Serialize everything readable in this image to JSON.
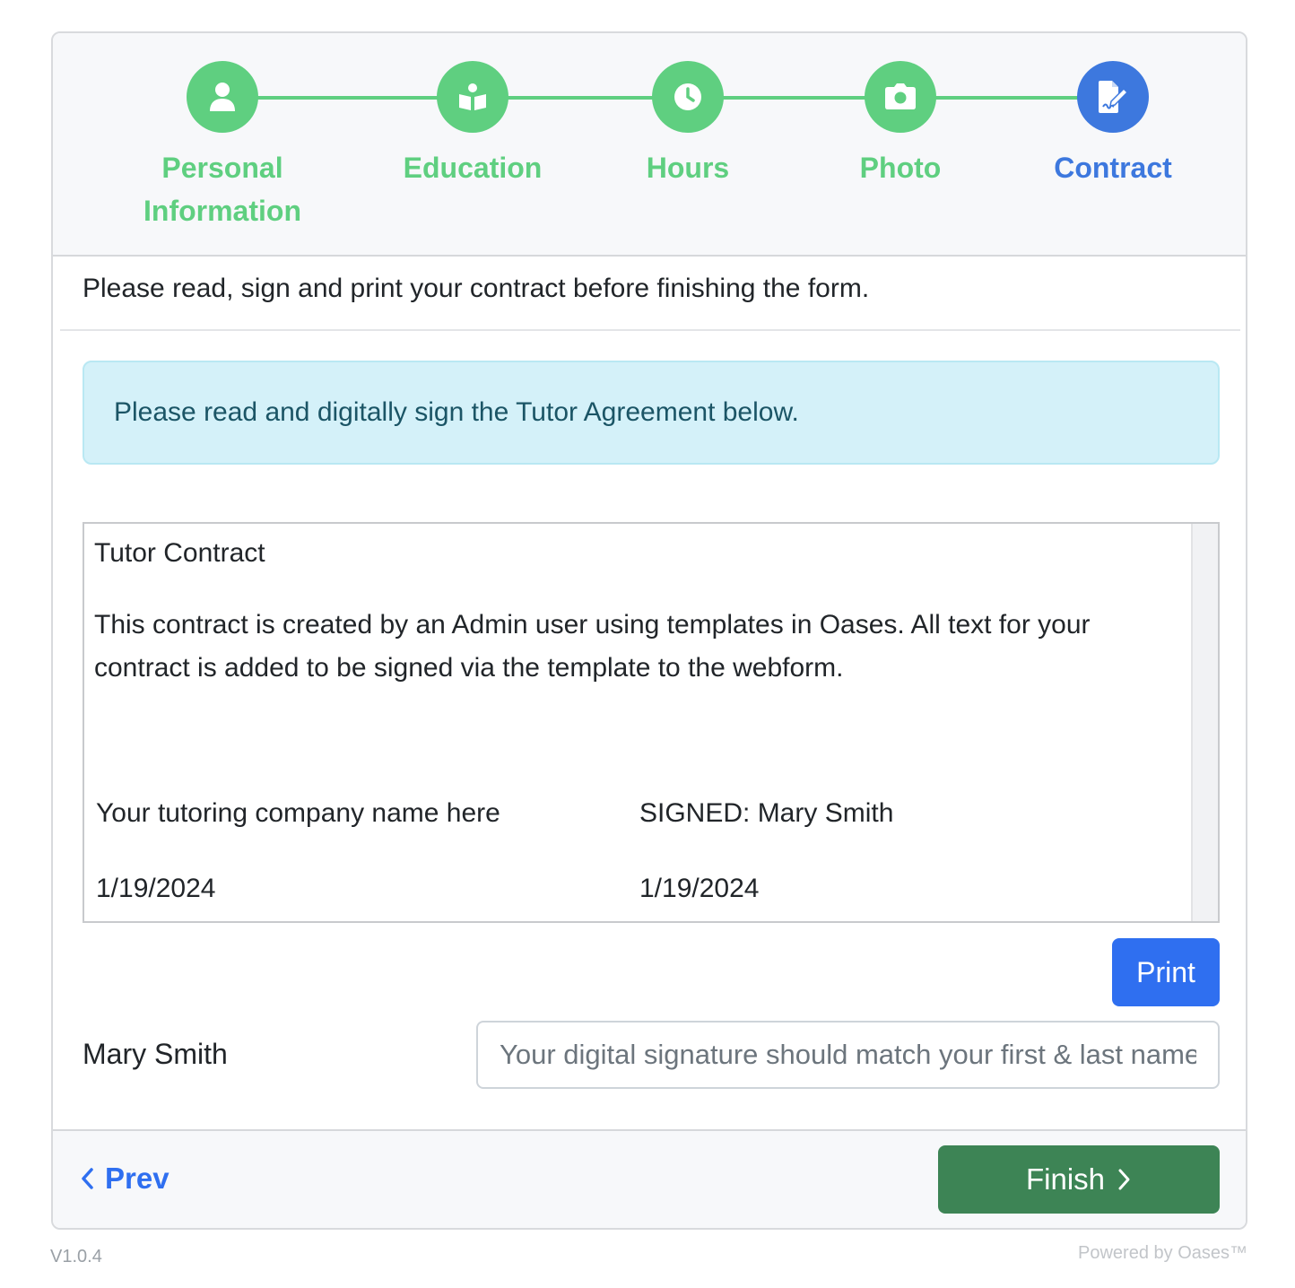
{
  "steps": [
    {
      "label_line1": "Personal",
      "label_line2": "Information",
      "icon": "user-icon",
      "state": "complete"
    },
    {
      "label_line1": "Education",
      "label_line2": "",
      "icon": "book-reader-icon",
      "state": "complete"
    },
    {
      "label_line1": "Hours",
      "label_line2": "",
      "icon": "clock-icon",
      "state": "complete"
    },
    {
      "label_line1": "Photo",
      "label_line2": "",
      "icon": "camera-icon",
      "state": "complete"
    },
    {
      "label_line1": "Contract",
      "label_line2": "",
      "icon": "file-signature-icon",
      "state": "active"
    }
  ],
  "colors": {
    "step_complete": "#5fcf80",
    "step_active": "#3d78de",
    "primary": "#2f6ff0",
    "finish": "#3d8455",
    "alert_bg": "#d4f1f9"
  },
  "intro_text": "Please read, sign and print your contract before finishing the form.",
  "alert_text": "Please read and digitally sign the Tutor Agreement below.",
  "contract": {
    "title": "Tutor Contract",
    "body_line1": "This contract is created by an Admin user using templates in Oases. All text for your",
    "body_line2": "contract is added to be signed via the template to the webform.",
    "company_name": "Your tutoring company name here",
    "signed_text": "SIGNED: Mary Smith",
    "company_date": "1/19/2024",
    "signed_date": "1/19/2024"
  },
  "print_label": "Print",
  "signature": {
    "name_label": "Mary Smith",
    "placeholder": "Your digital signature should match your first & last name"
  },
  "nav": {
    "prev_label": "Prev",
    "finish_label": "Finish"
  },
  "version": "V1.0.4",
  "powered_by": "Powered by Oases™"
}
